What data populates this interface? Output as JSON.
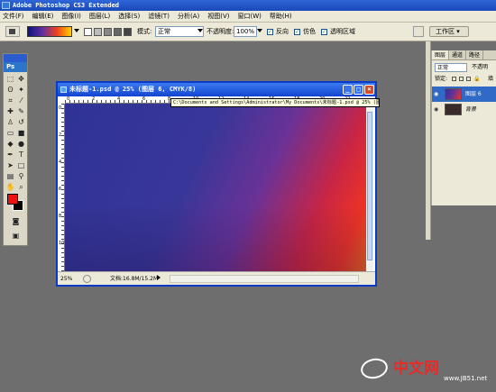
{
  "app": {
    "title": "Adobe Photoshop CS3 Extended"
  },
  "menu": [
    "文件(F)",
    "编辑(E)",
    "图像(I)",
    "图层(L)",
    "选择(S)",
    "滤镜(T)",
    "分析(A)",
    "视图(V)",
    "窗口(W)",
    "帮助(H)"
  ],
  "options": {
    "mode_label": "模式:",
    "mode_value": "正常",
    "opacity_label": "不透明度:",
    "opacity_value": "100%",
    "reverse_label": "反向",
    "dither_label": "仿色",
    "transparency_label": "透明区域",
    "workspace_label": "工作区 ▾"
  },
  "toolbox": {
    "badge": "Ps"
  },
  "document": {
    "title": "未标题-1.psd @ 25% (图层 6, CMYK/8)",
    "zoom": "25%",
    "doc_size": "文档:16.8M/15.2M",
    "ruler_marks": [
      "0",
      "2",
      "4",
      "6",
      "8",
      "10",
      "12",
      "14",
      "16",
      "18",
      "20",
      "22"
    ],
    "ruler_left_marks": [
      "0",
      "2",
      "4",
      "6",
      "8",
      "10"
    ]
  },
  "tooltip": "C:\\Documents and Settings\\Administrator\\My Documents\\未标题-1.psd @ 25% (图层 6, CMYK/8)",
  "layers_panel": {
    "tabs": [
      "图层",
      "通道",
      "路径"
    ],
    "blend_mode": "正常",
    "opacity_label": "不透明",
    "lock_label": "锁定:",
    "fill_label": "填",
    "layers": [
      {
        "name": "图层 6",
        "selected": true
      },
      {
        "name": "背景",
        "selected": false
      }
    ]
  },
  "watermark": {
    "text": "中文网",
    "url": "www.JB51.net"
  },
  "colors": {
    "foreground": "#ee1111",
    "background": "#000000",
    "accent": "#0a3bc8"
  }
}
